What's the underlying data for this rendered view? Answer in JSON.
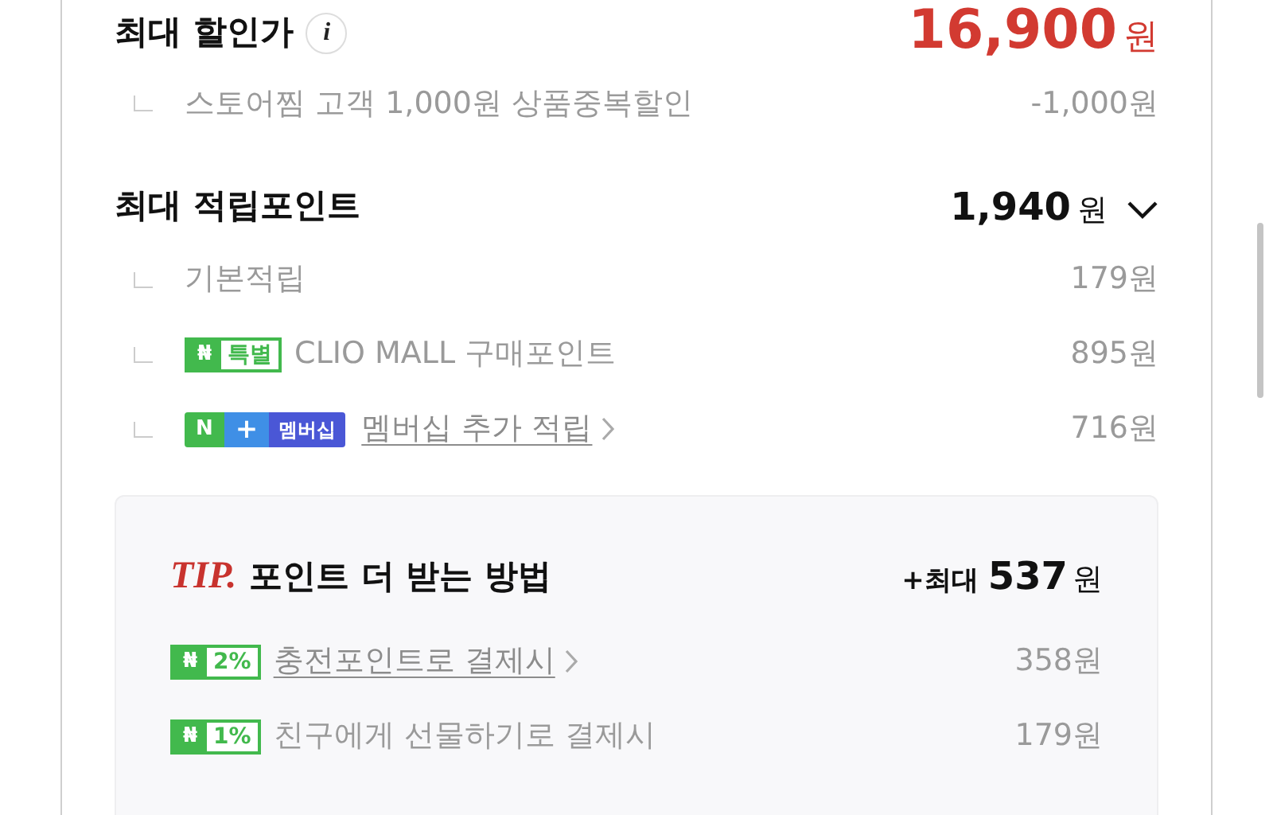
{
  "discount": {
    "title": "최대 할인가",
    "info_icon": "i",
    "price": "16,900",
    "unit": "원",
    "items": [
      {
        "text": "스토어찜 고객 1,000원 상품중복할인",
        "amount": "-1,000원"
      }
    ]
  },
  "points": {
    "title": "최대 적립포인트",
    "amount": "1,940",
    "unit": "원",
    "items": [
      {
        "kind": "plain",
        "text": "기본적립",
        "link": false,
        "amount": "179원"
      },
      {
        "kind": "special",
        "badge_logo": "₦",
        "badge_label": "특별",
        "text": "CLIO MALL 구매포인트",
        "link": false,
        "amount": "895원"
      },
      {
        "kind": "membership",
        "badge_logo": "N",
        "badge_plus": "+",
        "badge_label": "멤버십",
        "text": "멤버십 추가 적립",
        "link": true,
        "amount": "716원"
      }
    ]
  },
  "tip": {
    "label": "TIP.",
    "title": "포인트 더 받는 방법",
    "prefix": "+최대",
    "amount": "537",
    "unit": "원",
    "items": [
      {
        "badge_logo": "₦",
        "badge_label": "2%",
        "text": "충전포인트로 결제시",
        "link": true,
        "amount": "358원"
      },
      {
        "badge_logo": "₦",
        "badge_label": "1%",
        "text": "친구에게 선물하기로 결제시",
        "link": false,
        "amount": "179원"
      }
    ]
  }
}
